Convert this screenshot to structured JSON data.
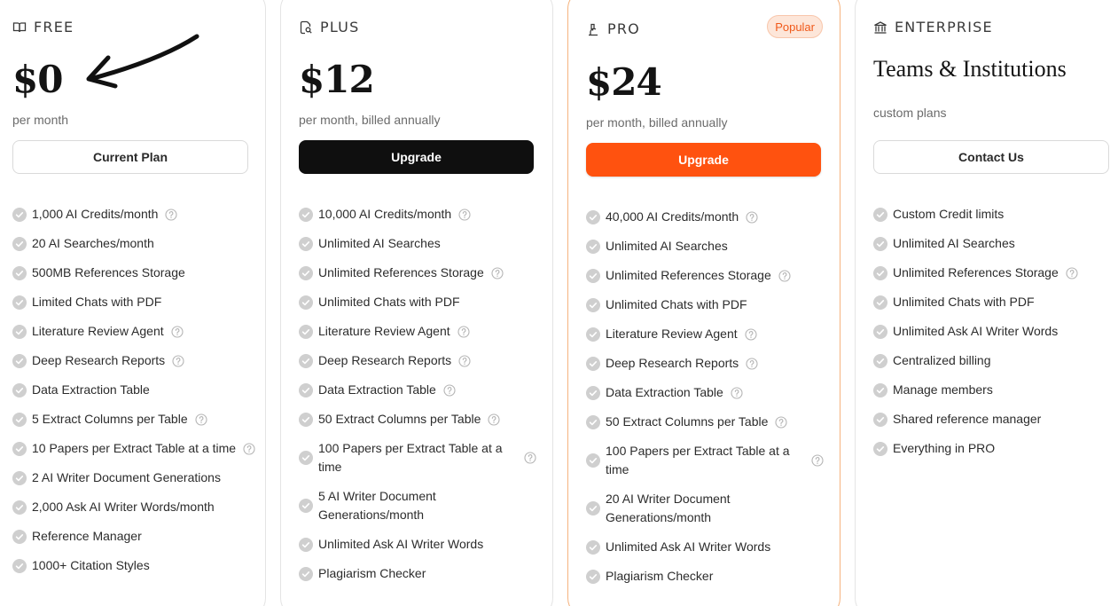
{
  "plans": [
    {
      "id": "free",
      "name": "FREE",
      "icon": "book-open-icon",
      "price": "$0",
      "period": "per month",
      "cta": "Current Plan",
      "features": [
        {
          "text": "1,000 AI Credits/month",
          "help": true
        },
        {
          "text": "20 AI Searches/month",
          "help": false
        },
        {
          "text": "500MB References Storage",
          "help": false
        },
        {
          "text": "Limited Chats with PDF",
          "help": false
        },
        {
          "text": "Literature Review Agent",
          "help": true
        },
        {
          "text": "Deep Research Reports",
          "help": true
        },
        {
          "text": "Data Extraction Table",
          "help": false
        },
        {
          "text": "5 Extract Columns per Table",
          "help": true
        },
        {
          "text": "10 Papers per Extract Table at a time",
          "help": true
        },
        {
          "text": "2 AI Writer Document Generations",
          "help": false
        },
        {
          "text": "2,000 Ask AI Writer Words/month",
          "help": false
        },
        {
          "text": "Reference Manager",
          "help": false
        },
        {
          "text": "1000+ Citation Styles",
          "help": false
        }
      ]
    },
    {
      "id": "plus",
      "name": "PLUS",
      "icon": "document-search-icon",
      "price": "$12",
      "period": "per month, billed annually",
      "cta": "Upgrade",
      "features": [
        {
          "text": "10,000 AI Credits/month",
          "help": true
        },
        {
          "text": "Unlimited AI Searches",
          "help": false
        },
        {
          "text": "Unlimited References Storage",
          "help": true
        },
        {
          "text": "Unlimited Chats with PDF",
          "help": false
        },
        {
          "text": "Literature Review Agent",
          "help": true
        },
        {
          "text": "Deep Research Reports",
          "help": true
        },
        {
          "text": "Data Extraction Table",
          "help": true
        },
        {
          "text": "50 Extract Columns per Table",
          "help": true
        },
        {
          "text": "100 Papers per Extract Table at a time",
          "help": true
        },
        {
          "text": "5 AI Writer Document Generations/month",
          "help": false
        },
        {
          "text": "Unlimited Ask AI Writer Words",
          "help": false
        },
        {
          "text": "Plagiarism Checker",
          "help": false
        }
      ]
    },
    {
      "id": "pro",
      "name": "PRO",
      "icon": "microscope-icon",
      "badge": "Popular",
      "price": "$24",
      "period": "per month, billed annually",
      "cta": "Upgrade",
      "features": [
        {
          "text": "40,000 AI Credits/month",
          "help": true
        },
        {
          "text": "Unlimited AI Searches",
          "help": false
        },
        {
          "text": "Unlimited References Storage",
          "help": true
        },
        {
          "text": "Unlimited Chats with PDF",
          "help": false
        },
        {
          "text": "Literature Review Agent",
          "help": true
        },
        {
          "text": "Deep Research Reports",
          "help": true
        },
        {
          "text": "Data Extraction Table",
          "help": true
        },
        {
          "text": "50 Extract Columns per Table",
          "help": true
        },
        {
          "text": "100 Papers per Extract Table at a time",
          "help": true
        },
        {
          "text": "20 AI Writer Document Generations/month",
          "help": false
        },
        {
          "text": "Unlimited Ask AI Writer Words",
          "help": false
        },
        {
          "text": "Plagiarism Checker",
          "help": false
        }
      ]
    },
    {
      "id": "enterprise",
      "name": "ENTERPRISE",
      "icon": "institution-icon",
      "title": "Teams & Institutions",
      "period": "custom plans",
      "cta": "Contact Us",
      "features": [
        {
          "text": "Custom Credit limits",
          "help": false
        },
        {
          "text": "Unlimited AI Searches",
          "help": false
        },
        {
          "text": "Unlimited References Storage",
          "help": true
        },
        {
          "text": "Unlimited Chats with PDF",
          "help": false
        },
        {
          "text": "Unlimited Ask AI Writer Words",
          "help": false
        },
        {
          "text": "Centralized billing",
          "help": false
        },
        {
          "text": "Manage members",
          "help": false
        },
        {
          "text": "Shared reference manager",
          "help": false
        },
        {
          "text": "Everything in PRO",
          "help": false
        }
      ]
    }
  ],
  "colors": {
    "accent": "#ff520f",
    "badge_bg": "#fde6d9",
    "check": "#c9c9c9",
    "dark_button": "#0f0f0f"
  }
}
